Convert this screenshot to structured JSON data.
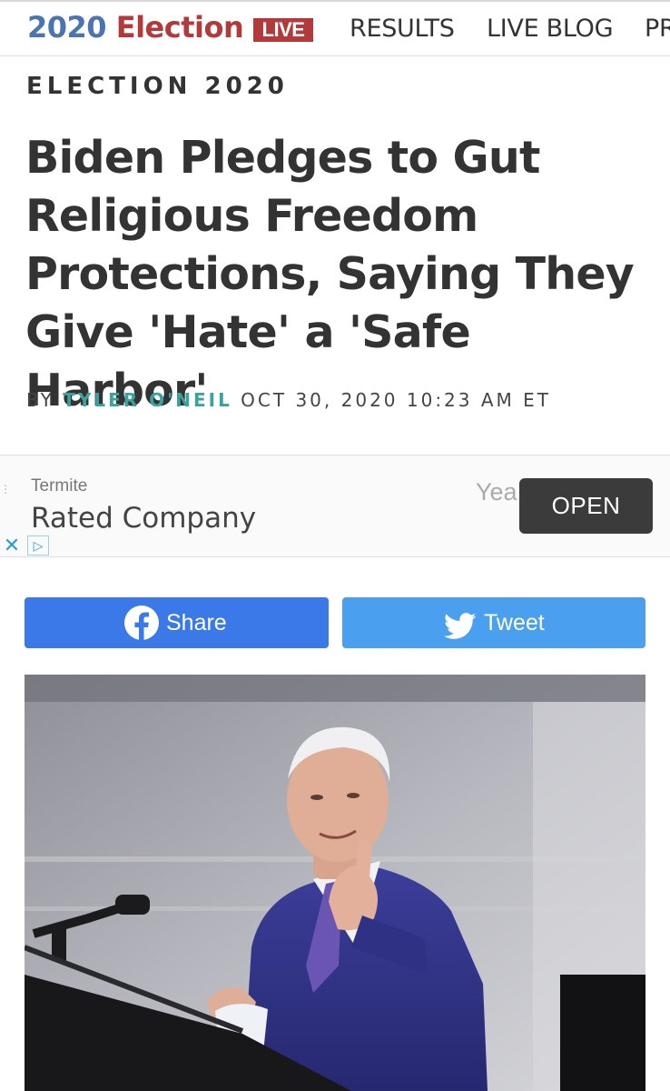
{
  "nav": {
    "brand_year": "2020",
    "brand_word": "Election",
    "live_badge": "LIVE",
    "links": [
      "RESULTS",
      "LIVE BLOG",
      "PR"
    ]
  },
  "article": {
    "section": "ELECTION 2020",
    "headline": "Biden Pledges to Gut Religious Freedom Protections, Saying They Give 'Hate' a 'Safe Harbor'",
    "by": "BY",
    "author": "TYLER O'NEIL",
    "date": "OCT 30, 2020 10:23 AM ET"
  },
  "ad": {
    "small_text": "Termite",
    "big_text": "Rated Company",
    "right_text": "Yea Sta",
    "open_label": "OPEN"
  },
  "share": {
    "facebook_label": "Share",
    "twitter_label": "Tweet"
  },
  "colors": {
    "brand_blue": "#4a74b3",
    "brand_red": "#b23a3a",
    "author_teal": "#3aa39d",
    "facebook_blue": "#3b79e8",
    "twitter_blue": "#4aa0ee"
  },
  "icons": [
    "facebook-icon",
    "twitter-icon",
    "close-icon",
    "ad-choices-icon"
  ]
}
